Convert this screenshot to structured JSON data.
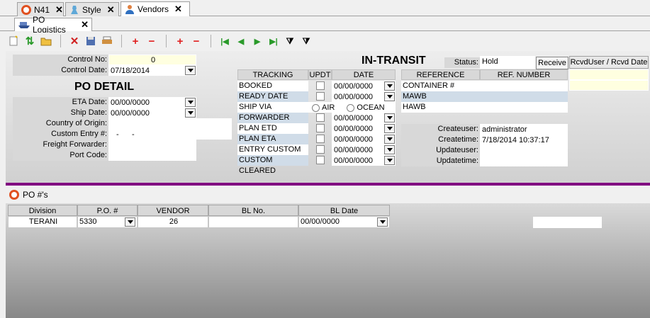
{
  "tabs": [
    {
      "label": "N41",
      "icon": "app-logo-icon"
    },
    {
      "label": "Style",
      "icon": "dress-icon"
    },
    {
      "label": "Vendors",
      "icon": "person-icon"
    }
  ],
  "subtab": {
    "label": "PO Logistics",
    "icon": "ship-icon"
  },
  "toolbar": {
    "icons": [
      "new-document-icon",
      "refresh-icon",
      "open-folder-icon",
      "delete-icon",
      "save-icon",
      "print-icon",
      "add-icon",
      "remove-icon",
      "add-row-icon",
      "remove-row-icon",
      "first-record-icon",
      "previous-record-icon",
      "next-record-icon",
      "last-record-icon",
      "filter-icon",
      "filter-clear-icon"
    ]
  },
  "form": {
    "control_no_label": "Control No:",
    "control_no": "0",
    "control_date_label": "Control Date:",
    "control_date": "07/18/2014",
    "po_detail_title": "PO DETAIL",
    "eta_date_label": "ETA Date:",
    "eta_date": "00/00/0000",
    "ship_date_label": "Ship Date:",
    "ship_date": "00/00/0000",
    "country_label": "Country of Origin:",
    "country": "",
    "custom_entry_label": "Custom Entry #:",
    "custom_entry": "-      -",
    "freight_label": "Freight Forwarder:",
    "freight": "",
    "port_label": "Port Code:",
    "port": ""
  },
  "transit": {
    "title": "IN-TRANSIT",
    "status_label": "Status:",
    "status": "Hold",
    "receive_button": "Receive",
    "rcvd_header": "RcvdUser / Rcvd Date",
    "col_tracking": "TRACKING",
    "col_updt": "UPDT",
    "col_date": "DATE",
    "rows": [
      {
        "label": "BOOKED",
        "date": "00/00/0000",
        "shade": "w"
      },
      {
        "label": "READY DATE",
        "date": "00/00/0000",
        "shade": "b"
      },
      {
        "label": "SHIP VIA",
        "shade": "w"
      },
      {
        "label": "FORWARDER",
        "date": "00/00/0000",
        "shade": "b"
      },
      {
        "label": "PLAN ETD",
        "date": "00/00/0000",
        "shade": "w"
      },
      {
        "label": "PLAN ETA",
        "date": "00/00/0000",
        "shade": "b"
      },
      {
        "label": "ENTRY CUSTOM",
        "date": "00/00/0000",
        "shade": "w"
      },
      {
        "label": "CUSTOM CLEARED",
        "date": "00/00/0000",
        "shade": "b"
      }
    ],
    "ship_air": "AIR",
    "ship_ocean": "OCEAN",
    "col_reference": "REFERENCE",
    "col_ref_number": "REF. NUMBER",
    "references": [
      "CONTAINER #",
      "MAWB",
      "HAWB"
    ],
    "createuser_label": "Createuser:",
    "createuser": "administrator",
    "createtime_label": "Createtime:",
    "createtime": "7/18/2014 10:37:17",
    "updateuser_label": "Updateuser:",
    "updateuser": "",
    "updatetime_label": "Updatetime:",
    "updatetime": ""
  },
  "po_grid": {
    "title": "PO #'s",
    "columns": [
      "Division",
      "P.O. #",
      "VENDOR",
      "BL No.",
      "BL Date"
    ],
    "rows": [
      {
        "division": "TERANI",
        "po": "5330",
        "vendor": "26",
        "bl_no": "",
        "bl_date": "00/00/0000"
      }
    ]
  },
  "colors": {
    "accent": "#800080",
    "highlight": "#ffffe0",
    "row_alt": "#d0dce8"
  }
}
